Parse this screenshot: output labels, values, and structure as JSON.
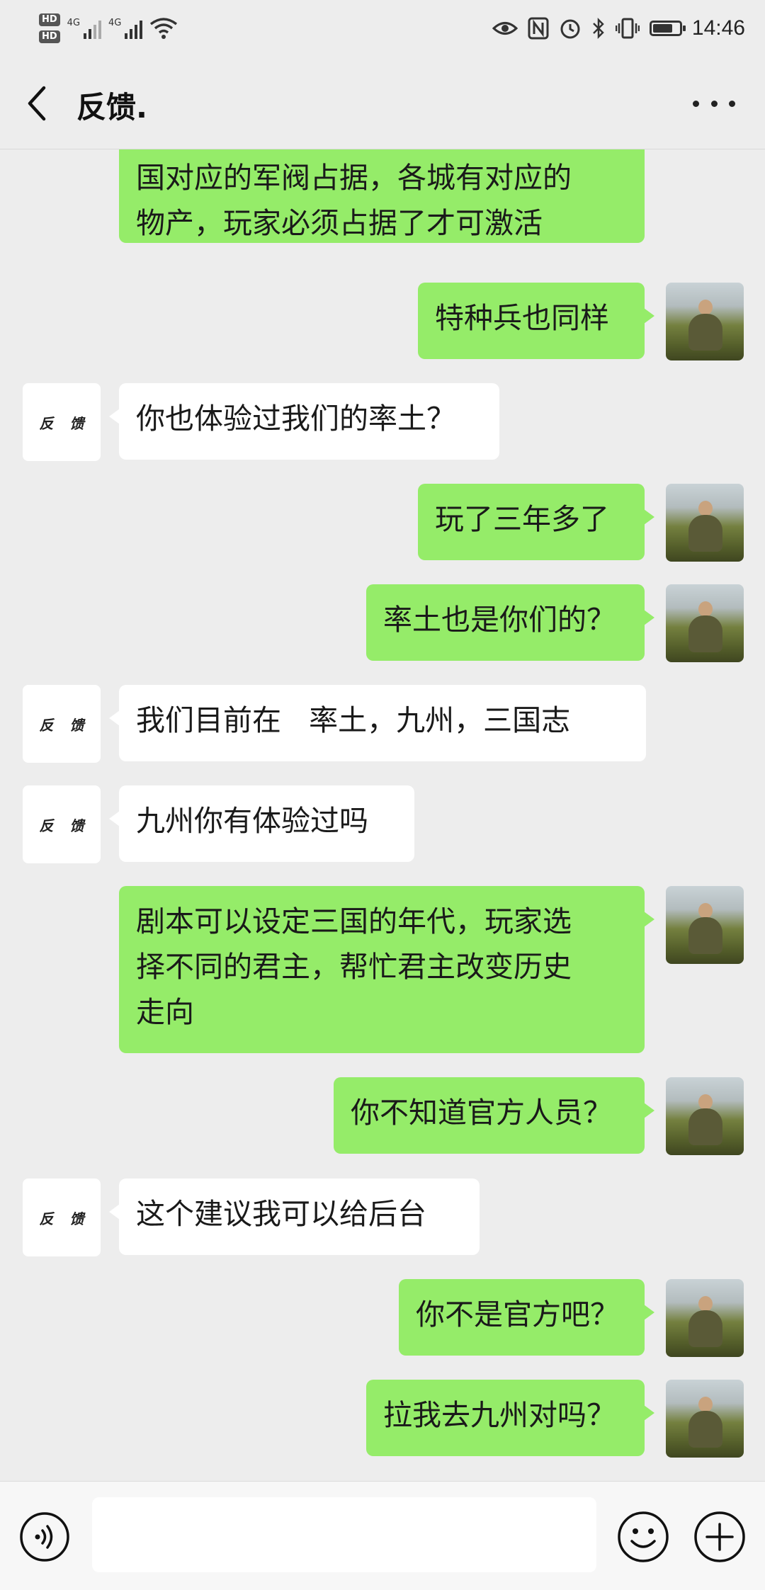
{
  "status_bar": {
    "hd1": "HD",
    "hd2": "HD",
    "net1": "4G",
    "net2": "4G",
    "time": "14:46",
    "battery_level": 0.75
  },
  "header": {
    "title": "反馈.",
    "back_icon": "chevron-left-icon",
    "more_icon": "more-dots-icon"
  },
  "contact_avatar_text": [
    "反",
    "馈"
  ],
  "messages": [
    {
      "side": "right",
      "text": "国对应的军阀占据，各城有对应的\n物产，玩家必须占据了才可激活",
      "continued": true
    },
    {
      "side": "right",
      "text": "特种兵也同样"
    },
    {
      "side": "left",
      "text": "你也体验过我们的率土？"
    },
    {
      "side": "right",
      "text": "玩了三年多了"
    },
    {
      "side": "right",
      "text": "率土也是你们的？"
    },
    {
      "side": "left",
      "text": "我们目前在   率土，九州，三国志"
    },
    {
      "side": "left",
      "text": "九州你有体验过吗"
    },
    {
      "side": "right",
      "text": "剧本可以设定三国的年代，玩家选\n择不同的君主，帮忙君主改变历史\n走向"
    },
    {
      "side": "right",
      "text": "你不知道官方人员？"
    },
    {
      "side": "left",
      "text": "这个建议我可以给后台"
    },
    {
      "side": "right",
      "text": "你不是官方吧？"
    },
    {
      "side": "right",
      "text": "拉我去九州对吗？"
    }
  ],
  "input_bar": {
    "voice_icon": "voice-input-icon",
    "message_value": "",
    "emoji_icon": "emoji-icon",
    "plus_icon": "plus-icon"
  },
  "colors": {
    "background": "#ededed",
    "outgoing_bubble": "#95ec69",
    "incoming_bubble": "#ffffff"
  }
}
